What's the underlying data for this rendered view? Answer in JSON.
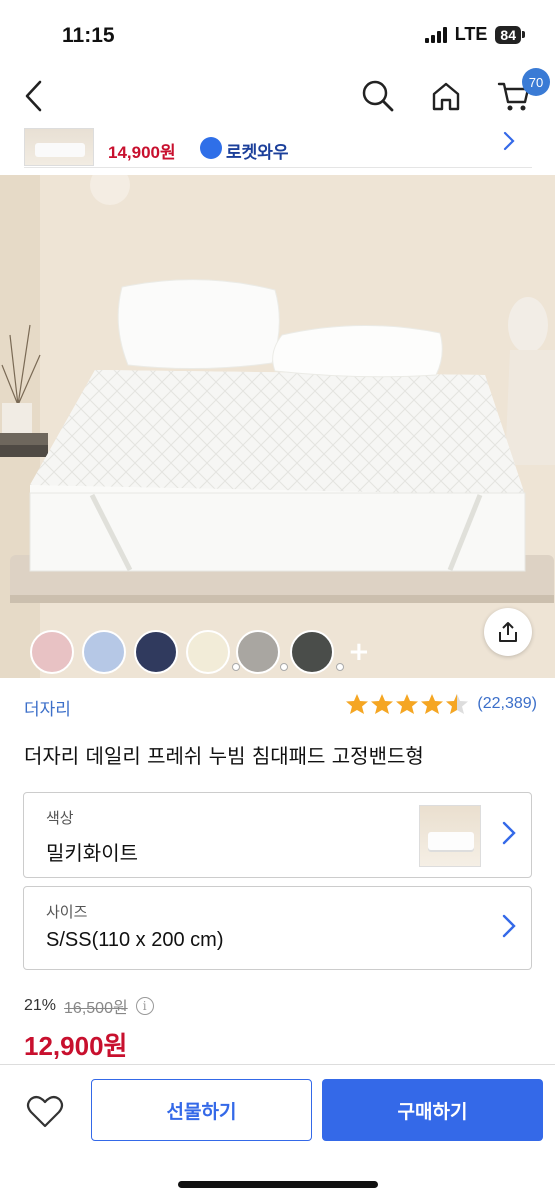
{
  "status": {
    "time": "11:15",
    "network": "LTE",
    "battery": "84"
  },
  "nav": {
    "cart_count": "70"
  },
  "mini_banner": {
    "price": "14,900원",
    "badge_label": "로켓와우"
  },
  "colors": {
    "accent": "#3469e8",
    "price_red": "#c8102e",
    "link_blue": "#3c6fc9",
    "star": "#f5a623"
  },
  "swatches": [
    "pink",
    "light-blue",
    "navy",
    "cream",
    "gray-pattern",
    "dark-floral"
  ],
  "product": {
    "brand": "더자리",
    "rating": 4.5,
    "review_count": "(22,389)",
    "title": "더자리 데일리 프레쉬 누빔 침대패드 고정밴드형"
  },
  "options": {
    "color": {
      "label": "색상",
      "value": "밀키화이트"
    },
    "size": {
      "label": "사이즈",
      "value": "S/SS(110 x 200 cm)"
    }
  },
  "price": {
    "discount_rate": "21%",
    "original": "16,500원",
    "sale": "12,900원"
  },
  "actions": {
    "gift": "선물하기",
    "buy": "구매하기"
  }
}
